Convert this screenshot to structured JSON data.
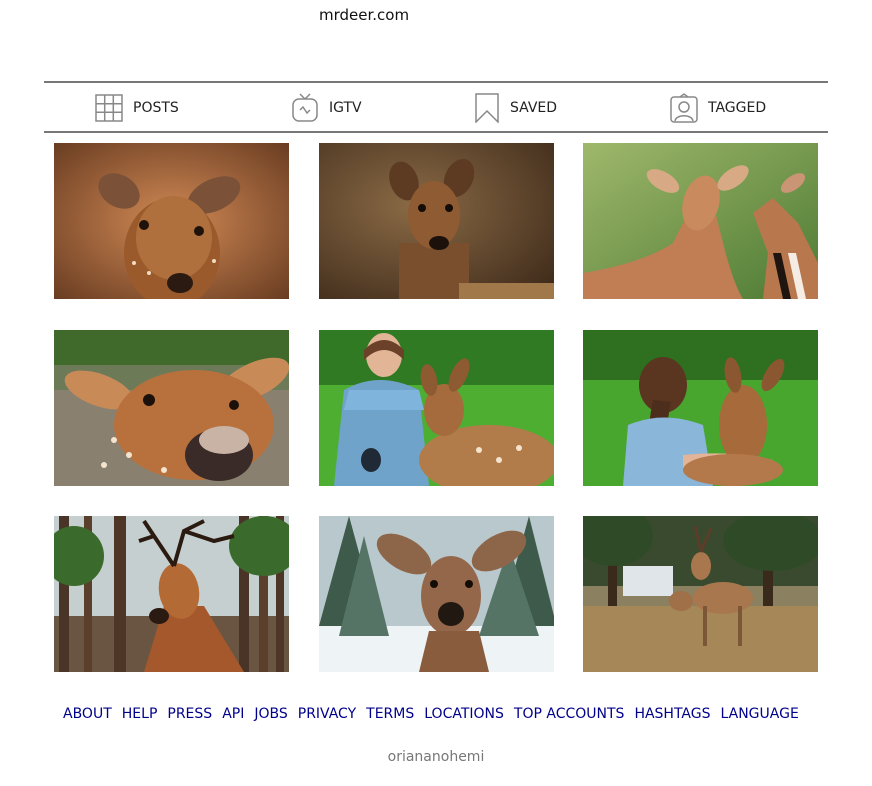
{
  "profile": {
    "website": "mrdeer.com"
  },
  "tabs": [
    {
      "label": "POSTS",
      "icon": "grid-icon"
    },
    {
      "label": "IGTV",
      "icon": "igtv-icon"
    },
    {
      "label": "SAVED",
      "icon": "bookmark-icon"
    },
    {
      "label": "TAGGED",
      "icon": "tagged-person-icon"
    }
  ],
  "posts": [
    {
      "subject": "close-up of a young spotted deer"
    },
    {
      "subject": "roe deer portrait"
    },
    {
      "subject": "two impalas facing each other"
    },
    {
      "subject": "fallow deer nose close-up"
    },
    {
      "subject": "girl feeding a fawn"
    },
    {
      "subject": "girl hugging a fawn"
    },
    {
      "subject": "stag with antlers in pine forest"
    },
    {
      "subject": "deer in snowy forest"
    },
    {
      "subject": "deer in sunlit park"
    }
  ],
  "footer": {
    "links": [
      "ABOUT",
      "HELP",
      "PRESS",
      "API",
      "JOBS",
      "PRIVACY",
      "TERMS",
      "LOCATIONS",
      "TOP ACCOUNTS",
      "HASHTAGS",
      "LANGUAGE"
    ],
    "copyright": "oriananohemi"
  },
  "colors": {
    "link": "#00008b",
    "divider": "#777777",
    "muted": "#777777"
  }
}
